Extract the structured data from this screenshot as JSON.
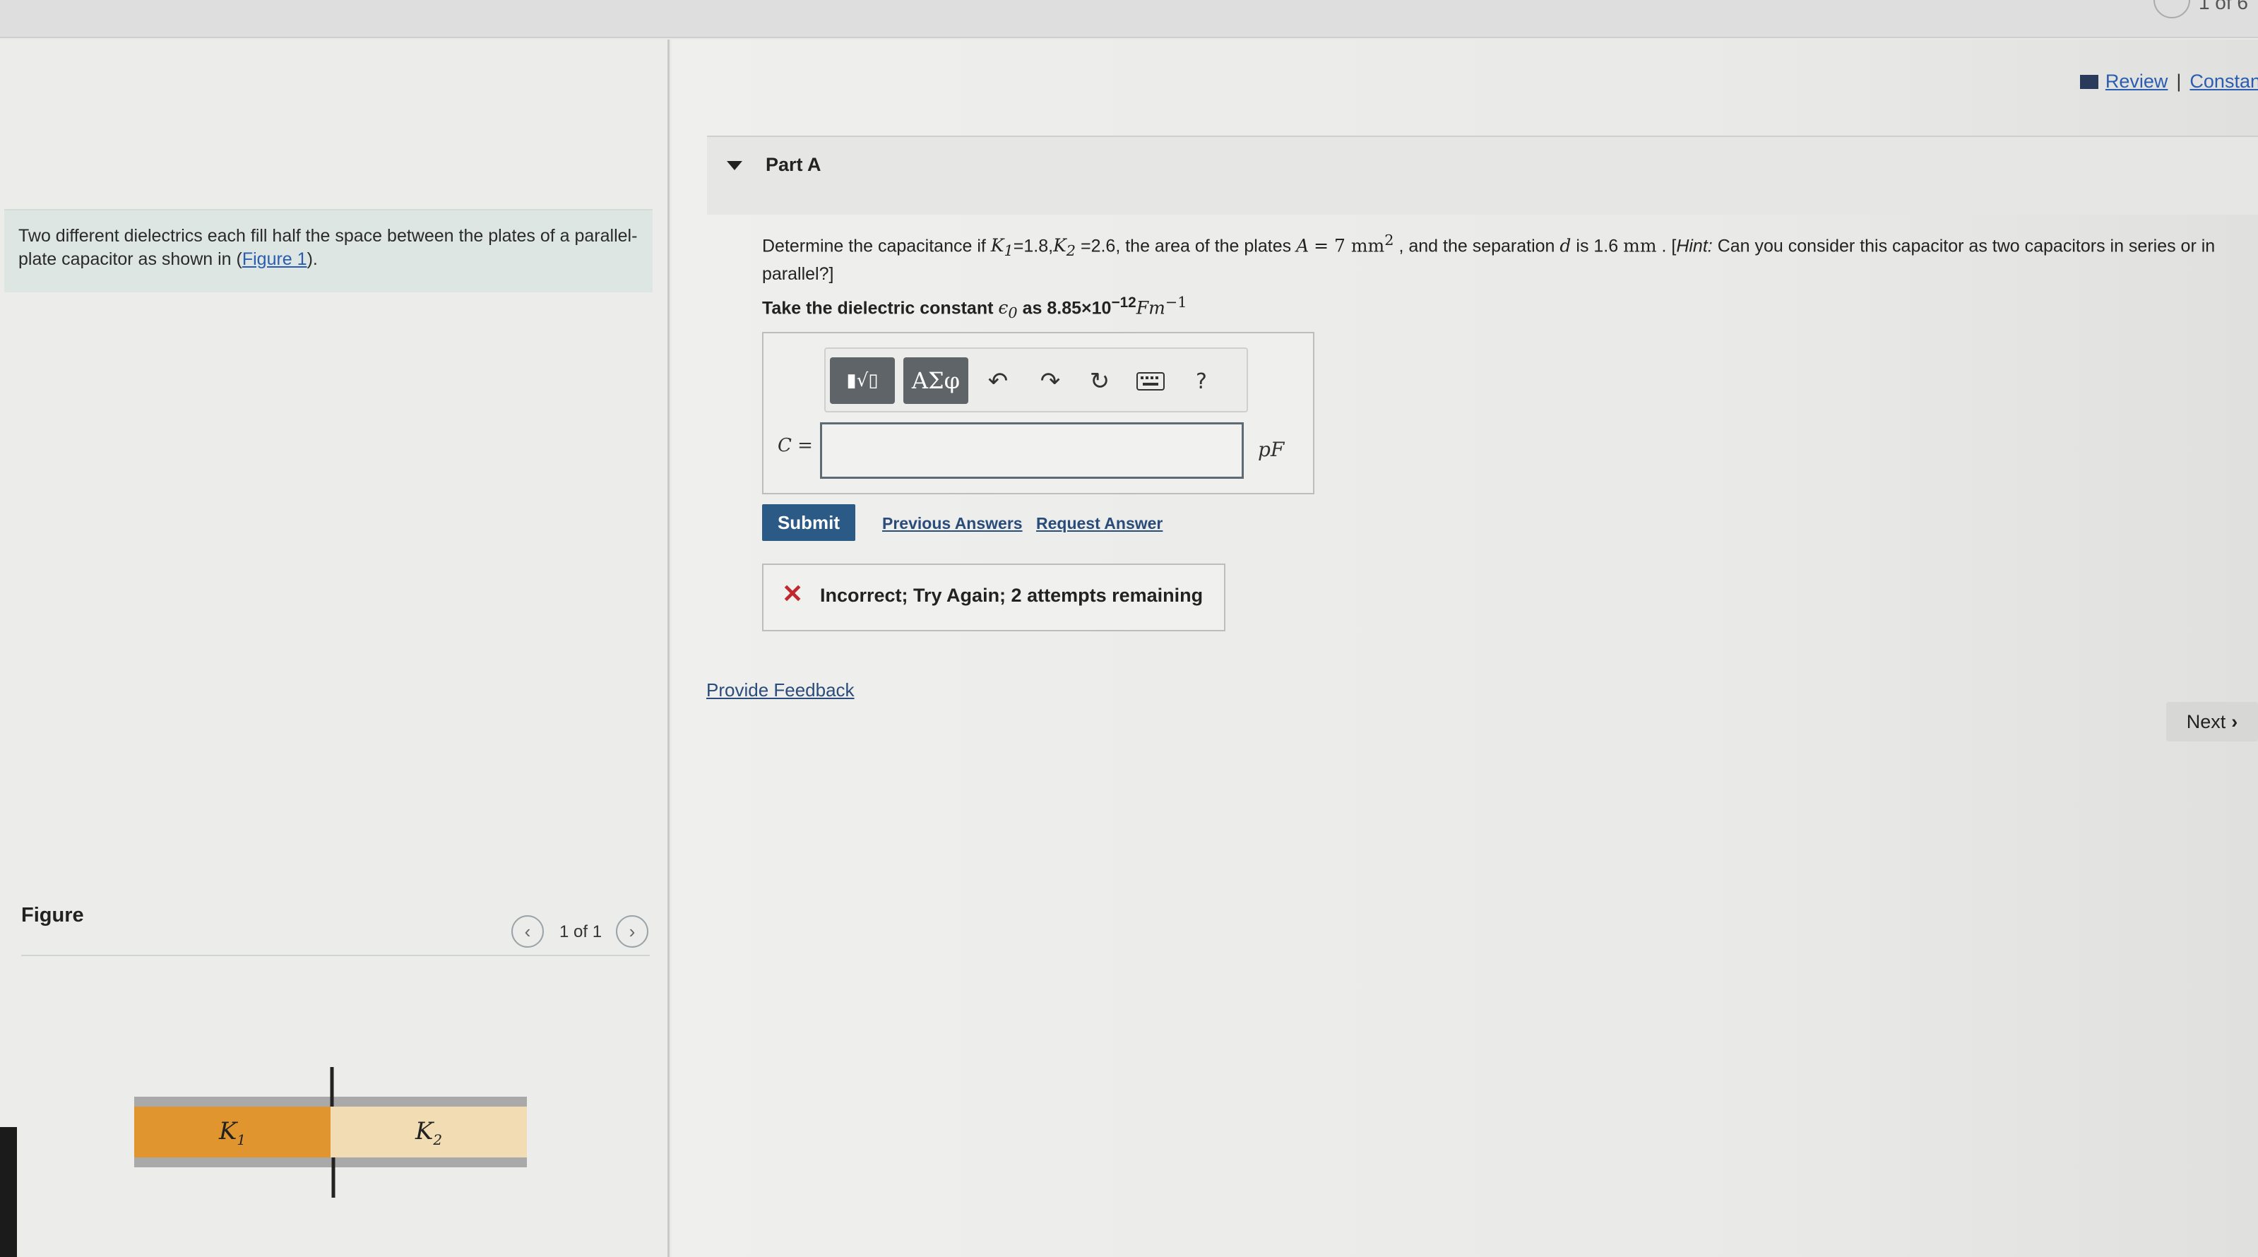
{
  "topbar": {
    "pager": "1 of 6"
  },
  "problem": {
    "intro": "Two different dielectrics each fill half the space between the plates of a parallel-plate capacitor as shown in (",
    "figure_link": "Figure 1",
    "intro_end": ")."
  },
  "figure": {
    "title": "Figure",
    "count": "1 of 1",
    "label_k1": "K1",
    "label_k2": "K2"
  },
  "links": {
    "review": "Review",
    "separator": "|",
    "constants": "Constan"
  },
  "part": {
    "title": "Part A"
  },
  "question": {
    "intro": "Determine  the capacitance if",
    "k1_value": "=1.8,",
    "k2_value": "=2.6, the area of the plates",
    "area": "= 7 mm",
    "area_sup": "2",
    "sep_text": ", and the separation",
    "d_value": "is 1.6",
    "d_unit": "mm",
    "hint_label": "Hint:",
    "hint": "Can you consider this capacitor as two capacitors in series or in parallel?]",
    "hint_open": ". [",
    "take_prefix": "Take the dielectric constant",
    "take_value": "as 8.85×10",
    "take_exp": "−12",
    "take_unit": "Fm",
    "take_unit_exp": "−1"
  },
  "toolbar": {
    "templates": "▮√▯",
    "greek": "ΑΣφ",
    "help": "?"
  },
  "answer": {
    "label": "C =",
    "value": "",
    "unit": "pF"
  },
  "actions": {
    "submit": "Submit",
    "previous_answers": "Previous Answers",
    "request_answer": "Request Answer"
  },
  "feedback": {
    "message": "Incorrect; Try Again; 2 attempts remaining"
  },
  "provide_feedback": "Provide Feedback",
  "next": "Next"
}
